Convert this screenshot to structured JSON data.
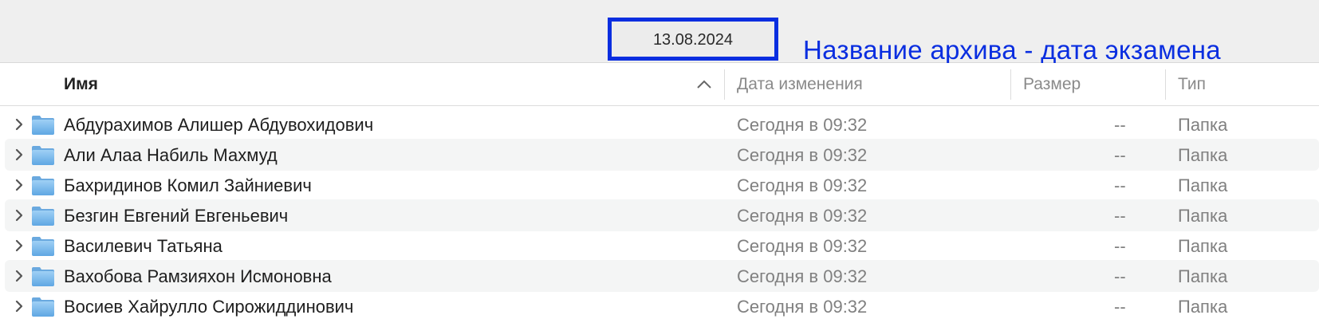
{
  "window": {
    "title": "13.08.2024"
  },
  "annotation": {
    "text": "Название архива - дата экзамена",
    "color": "#0a2ee0"
  },
  "columns": {
    "name": "Имя",
    "date": "Дата изменения",
    "size": "Размер",
    "kind": "Тип",
    "sort": "ascending"
  },
  "rows": [
    {
      "name": "Абдурахимов Алишер Абдувохидович",
      "date": "Сегодня в 09:32",
      "size": "--",
      "kind": "Папка",
      "icon": "folder-icon"
    },
    {
      "name": "Али Алаа Набиль Махмуд",
      "date": "Сегодня в 09:32",
      "size": "--",
      "kind": "Папка",
      "icon": "folder-icon"
    },
    {
      "name": "Бахридинов Комил Зайниевич",
      "date": "Сегодня в 09:32",
      "size": "--",
      "kind": "Папка",
      "icon": "folder-icon"
    },
    {
      "name": "Безгин Евгений Евгеньевич",
      "date": "Сегодня в 09:32",
      "size": "--",
      "kind": "Папка",
      "icon": "folder-icon"
    },
    {
      "name": "Василевич Татьяна",
      "date": "Сегодня в 09:32",
      "size": "--",
      "kind": "Папка",
      "icon": "folder-icon"
    },
    {
      "name": "Вахобова Рамзияхон Исмоновна",
      "date": "Сегодня в 09:32",
      "size": "--",
      "kind": "Папка",
      "icon": "folder-icon"
    },
    {
      "name": "Восиев Хайрулло Сирожиддинович",
      "date": "Сегодня в 09:32",
      "size": "--",
      "kind": "Папка",
      "icon": "folder-icon"
    }
  ]
}
